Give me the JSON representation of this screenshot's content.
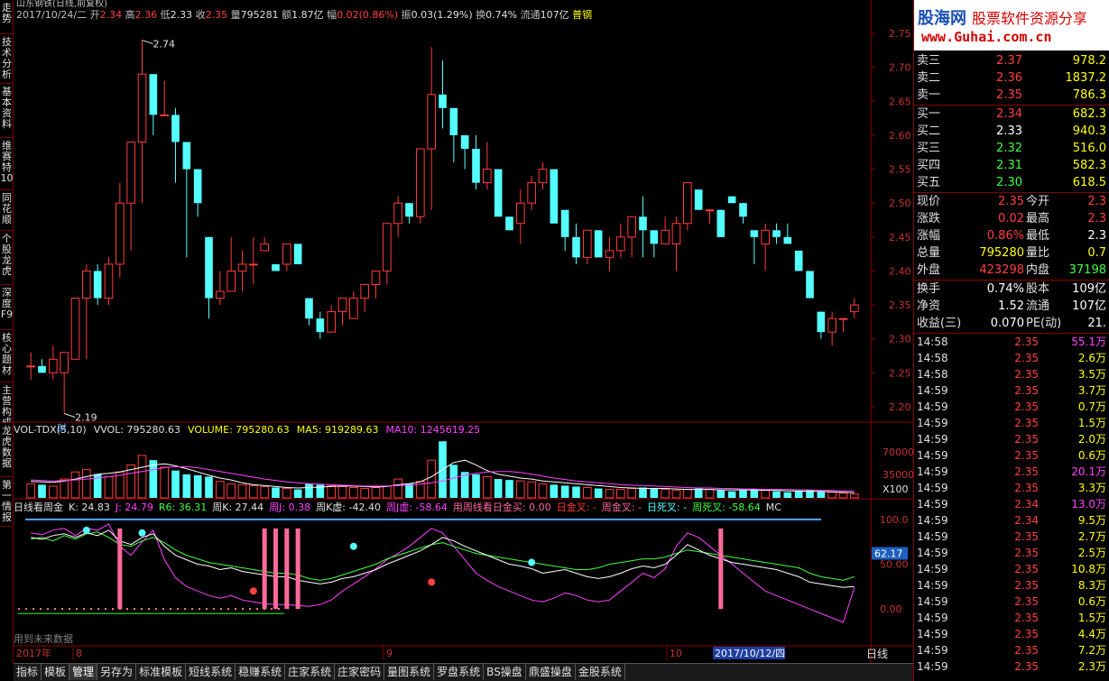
{
  "colors": {
    "up": "#ff3b3b",
    "down": "#54ffff",
    "grid": "#8b0000",
    "axis_text": "#c83232",
    "yellow": "#ffff00",
    "magenta": "#ff40ff",
    "green": "#40ff40",
    "white": "#ffffff",
    "blue": "#4fa8ff",
    "pink": "#ff6a9a"
  },
  "left_tabs": [
    "走势",
    "技术分析",
    "基本资料",
    "维赛特10",
    "同花顺",
    "个股龙虎",
    "深度F9",
    "核心题材",
    "主营构成",
    "龙虎数据",
    "第一情报"
  ],
  "header": {
    "title": "山东钢铁(日线,前复权)",
    "date": "2017/10/24/二",
    "open_label": "开",
    "open": "2.34",
    "high_label": "高",
    "high": "2.36",
    "low_label": "低",
    "low": "2.33",
    "close_label": "收",
    "close": "2.35",
    "vol_label": "量",
    "vol": "795281",
    "amt_label": "额",
    "amt": "1.87亿",
    "chg_label": "幅",
    "chg": "0.02(0.86%)",
    "amp_label": "振",
    "amp": "0.03(1.29%)",
    "turn_label": "换",
    "turn": "0.74%",
    "float_label": "流通",
    "float": "107亿",
    "industry": "普钢"
  },
  "price_axis": {
    "ticks": [
      "2.75",
      "2.70",
      "2.65",
      "2.60",
      "2.55",
      "2.50",
      "2.45",
      "2.40",
      "2.35",
      "2.30",
      "2.25",
      "2.20"
    ],
    "max_label": "2.74",
    "min_label": "2.19",
    "fin_marker": "财"
  },
  "volume_panel": {
    "name": "VOL-TDX(5,10)",
    "vvol": "VVOL: 795280.63",
    "volume": "VOLUME: 795280.63",
    "ma5": "MA5: 919289.63",
    "ma10": "MA10: 1245619.25",
    "ticks": [
      "70000",
      "35000"
    ],
    "unit": "X100"
  },
  "kdj_panel": {
    "name": "日线看周金",
    "k": "K: 24.83",
    "j": "J: 24.79",
    "r6": "R6: 36.31",
    "zk": "周K: 27.44",
    "zj": "周J: 0.38",
    "zkx": "周K虚: -42.40",
    "zjx": "周J虚: -58.64",
    "buy": "用周线看日金买: 0.00",
    "rjc": "日金叉: -",
    "zjc": "周金叉: -",
    "rsc": "日死叉: -",
    "zsc": "周死叉: -58.64",
    "mc": "MC",
    "ticks": [
      "100.0",
      "50.00",
      "0.00"
    ],
    "cur_value": "62.17",
    "future_note": "用到未来数据"
  },
  "date_axis": {
    "year": "2017年",
    "m8": "8",
    "m9": "9",
    "m10": "10",
    "cursor_date": "2017/10/12/四"
  },
  "period": "日线",
  "bottom_tabs": [
    "指标",
    "模板",
    "管理",
    "另存为",
    "标准模板",
    "短线系统",
    "稳赚系统",
    "庄家系统",
    "庄家密码",
    "量图系统",
    "罗盘系统",
    "BS操盘",
    "鼎盛操盘",
    "金股系统"
  ],
  "logo": {
    "name": "股海网",
    "slogan": "股票软件资源分享",
    "url": "www.Guhai.com.cn"
  },
  "sell_book": [
    {
      "label": "卖三",
      "price": "2.37",
      "vol": "978.2"
    },
    {
      "label": "卖二",
      "price": "2.36",
      "vol": "1837.2"
    },
    {
      "label": "卖一",
      "price": "2.35",
      "vol": "786.3"
    }
  ],
  "buy_book": [
    {
      "label": "买一",
      "price": "2.34",
      "vol": "682.3"
    },
    {
      "label": "买二",
      "price": "2.33",
      "vol": "940.3"
    },
    {
      "label": "买三",
      "price": "2.32",
      "vol": "516.0"
    },
    {
      "label": "买四",
      "price": "2.31",
      "vol": "582.3"
    },
    {
      "label": "买五",
      "price": "2.30",
      "vol": "618.5"
    }
  ],
  "stats": [
    {
      "k1": "现价",
      "v1": "2.35",
      "k2": "今开",
      "v2": "2.3"
    },
    {
      "k1": "涨跌",
      "v1": "0.02",
      "k2": "最高",
      "v2": "2.3"
    },
    {
      "k1": "涨幅",
      "v1": "0.86%",
      "k2": "最低",
      "v2": "2.3"
    },
    {
      "k1": "总量",
      "v1": "795280",
      "k2": "量比",
      "v2": "0.7"
    },
    {
      "k1": "外盘",
      "v1": "423298",
      "k2": "内盘",
      "v2": "37198"
    }
  ],
  "fund": [
    {
      "k1": "换手",
      "v1": "0.74%",
      "k2": "股本",
      "v2": "109亿"
    },
    {
      "k1": "净资",
      "v1": "1.52",
      "k2": "流通",
      "v2": "107亿"
    },
    {
      "k1": "收益(三)",
      "v1": "0.070",
      "k2": "PE(动)",
      "v2": "21."
    }
  ],
  "ticks": [
    {
      "t": "14:58",
      "p": "2.35",
      "v": "55.1万",
      "c": "magenta"
    },
    {
      "t": "14:58",
      "p": "2.35",
      "v": "2.6万",
      "c": "yellow"
    },
    {
      "t": "14:58",
      "p": "2.35",
      "v": "3.5万",
      "c": "yellow"
    },
    {
      "t": "14:59",
      "p": "2.35",
      "v": "3.7万",
      "c": "yellow"
    },
    {
      "t": "14:59",
      "p": "2.35",
      "v": "0.7万",
      "c": "yellow"
    },
    {
      "t": "14:59",
      "p": "2.35",
      "v": "1.5万",
      "c": "yellow"
    },
    {
      "t": "14:59",
      "p": "2.35",
      "v": "2.0万",
      "c": "yellow"
    },
    {
      "t": "14:59",
      "p": "2.35",
      "v": "0.6万",
      "c": "yellow"
    },
    {
      "t": "14:59",
      "p": "2.35",
      "v": "20.1万",
      "c": "magenta"
    },
    {
      "t": "14:59",
      "p": "2.35",
      "v": "3.3万",
      "c": "yellow"
    },
    {
      "t": "14:59",
      "p": "2.34",
      "v": "13.0万",
      "c": "magenta"
    },
    {
      "t": "14:59",
      "p": "2.34",
      "v": "9.5万",
      "c": "yellow"
    },
    {
      "t": "14:59",
      "p": "2.35",
      "v": "2.7万",
      "c": "yellow"
    },
    {
      "t": "14:59",
      "p": "2.35",
      "v": "2.5万",
      "c": "yellow"
    },
    {
      "t": "14:59",
      "p": "2.35",
      "v": "10.8万",
      "c": "yellow"
    },
    {
      "t": "14:59",
      "p": "2.35",
      "v": "8.3万",
      "c": "yellow"
    },
    {
      "t": "14:59",
      "p": "2.35",
      "v": "0.6万",
      "c": "yellow"
    },
    {
      "t": "14:59",
      "p": "2.35",
      "v": "1.5万",
      "c": "yellow"
    },
    {
      "t": "14:59",
      "p": "2.35",
      "v": "4.4万",
      "c": "yellow"
    },
    {
      "t": "14:59",
      "p": "2.35",
      "v": "7.2万",
      "c": "yellow"
    },
    {
      "t": "14:59",
      "p": "2.35",
      "v": "2.3万",
      "c": "yellow"
    }
  ],
  "chart_data": {
    "type": "candlestick",
    "title": "山东钢铁(日线,前复权)",
    "ylim": [
      2.18,
      2.77
    ],
    "max": 2.74,
    "min": 2.19,
    "candles": [
      [
        2.26,
        2.28,
        2.24,
        2.26
      ],
      [
        2.26,
        2.27,
        2.25,
        2.25
      ],
      [
        2.25,
        2.29,
        2.24,
        2.27
      ],
      [
        2.25,
        2.28,
        2.19,
        2.28
      ],
      [
        2.27,
        2.36,
        2.27,
        2.36
      ],
      [
        2.36,
        2.41,
        2.27,
        2.4
      ],
      [
        2.4,
        2.41,
        2.35,
        2.36
      ],
      [
        2.36,
        2.42,
        2.35,
        2.41
      ],
      [
        2.41,
        2.53,
        2.39,
        2.5
      ],
      [
        2.5,
        2.59,
        2.43,
        2.59
      ],
      [
        2.59,
        2.74,
        2.5,
        2.69
      ],
      [
        2.69,
        2.69,
        2.6,
        2.63
      ],
      [
        2.63,
        2.68,
        2.63,
        2.63
      ],
      [
        2.63,
        2.64,
        2.53,
        2.59
      ],
      [
        2.59,
        2.59,
        2.42,
        2.55
      ],
      [
        2.55,
        2.55,
        2.48,
        2.5
      ],
      [
        2.45,
        2.45,
        2.33,
        2.36
      ],
      [
        2.36,
        2.4,
        2.35,
        2.37
      ],
      [
        2.37,
        2.45,
        2.37,
        2.4
      ],
      [
        2.4,
        2.43,
        2.37,
        2.41
      ],
      [
        2.41,
        2.45,
        2.38,
        2.41
      ],
      [
        2.43,
        2.45,
        2.43,
        2.44
      ],
      [
        2.41,
        2.41,
        2.4,
        2.4
      ],
      [
        2.41,
        2.44,
        2.4,
        2.44
      ],
      [
        2.44,
        2.44,
        2.41,
        2.41
      ],
      [
        2.36,
        2.36,
        2.32,
        2.33
      ],
      [
        2.33,
        2.34,
        2.3,
        2.31
      ],
      [
        2.31,
        2.35,
        2.31,
        2.34
      ],
      [
        2.34,
        2.36,
        2.32,
        2.36
      ],
      [
        2.33,
        2.37,
        2.33,
        2.36
      ],
      [
        2.36,
        2.38,
        2.34,
        2.38
      ],
      [
        2.38,
        2.4,
        2.36,
        2.4
      ],
      [
        2.4,
        2.47,
        2.38,
        2.47
      ],
      [
        2.47,
        2.51,
        2.45,
        2.5
      ],
      [
        2.5,
        2.5,
        2.47,
        2.48
      ],
      [
        2.48,
        2.58,
        2.47,
        2.58
      ],
      [
        2.58,
        2.73,
        2.49,
        2.66
      ],
      [
        2.66,
        2.71,
        2.61,
        2.64
      ],
      [
        2.64,
        2.64,
        2.56,
        2.6
      ],
      [
        2.6,
        2.6,
        2.55,
        2.58
      ],
      [
        2.58,
        2.6,
        2.52,
        2.53
      ],
      [
        2.53,
        2.59,
        2.52,
        2.55
      ],
      [
        2.55,
        2.55,
        2.48,
        2.48
      ],
      [
        2.48,
        2.48,
        2.46,
        2.46
      ],
      [
        2.47,
        2.52,
        2.44,
        2.5
      ],
      [
        2.5,
        2.54,
        2.49,
        2.53
      ],
      [
        2.53,
        2.56,
        2.52,
        2.55
      ],
      [
        2.55,
        2.55,
        2.47,
        2.47
      ],
      [
        2.49,
        2.49,
        2.43,
        2.45
      ],
      [
        2.45,
        2.47,
        2.41,
        2.42
      ],
      [
        2.42,
        2.46,
        2.41,
        2.46
      ],
      [
        2.46,
        2.46,
        2.42,
        2.42
      ],
      [
        2.42,
        2.45,
        2.4,
        2.43
      ],
      [
        2.43,
        2.47,
        2.42,
        2.45
      ],
      [
        2.45,
        2.48,
        2.42,
        2.48
      ],
      [
        2.48,
        2.51,
        2.42,
        2.46
      ],
      [
        2.46,
        2.46,
        2.42,
        2.44
      ],
      [
        2.44,
        2.48,
        2.44,
        2.46
      ],
      [
        2.44,
        2.48,
        2.4,
        2.47
      ],
      [
        2.47,
        2.53,
        2.46,
        2.53
      ],
      [
        2.52,
        2.52,
        2.49,
        2.49
      ],
      [
        2.49,
        2.49,
        2.47,
        2.49
      ],
      [
        2.49,
        2.49,
        2.45,
        2.45
      ],
      [
        2.51,
        2.51,
        2.5,
        2.5
      ],
      [
        2.5,
        2.5,
        2.47,
        2.48
      ],
      [
        2.46,
        2.46,
        2.41,
        2.45
      ],
      [
        2.44,
        2.47,
        2.4,
        2.46
      ],
      [
        2.46,
        2.47,
        2.44,
        2.45
      ],
      [
        2.45,
        2.47,
        2.44,
        2.44
      ],
      [
        2.43,
        2.43,
        2.4,
        2.4
      ],
      [
        2.4,
        2.4,
        2.36,
        2.36
      ],
      [
        2.34,
        2.34,
        2.3,
        2.31
      ],
      [
        2.31,
        2.34,
        2.29,
        2.33
      ],
      [
        2.33,
        2.33,
        2.31,
        2.33
      ],
      [
        2.34,
        2.36,
        2.33,
        2.35
      ]
    ],
    "volume": [
      30,
      28,
      25,
      40,
      55,
      60,
      50,
      45,
      55,
      70,
      90,
      80,
      65,
      58,
      50,
      48,
      45,
      35,
      30,
      28,
      26,
      24,
      22,
      20,
      18,
      30,
      28,
      26,
      24,
      22,
      20,
      22,
      25,
      40,
      30,
      35,
      80,
      120,
      70,
      55,
      50,
      45,
      40,
      38,
      36,
      34,
      30,
      28,
      26,
      24,
      22,
      20,
      18,
      18,
      20,
      22,
      20,
      18,
      16,
      18,
      20,
      18,
      16,
      14,
      16,
      18,
      16,
      14,
      12,
      14,
      16,
      14,
      12,
      10,
      8
    ],
    "vol_ma5": [
      35,
      34,
      33,
      36,
      40,
      45,
      50,
      52,
      55,
      60,
      65,
      70,
      72,
      68,
      62,
      55,
      48,
      42,
      38,
      32,
      28,
      26,
      24,
      22,
      21,
      22,
      23,
      24,
      25,
      25,
      24,
      23,
      24,
      28,
      30,
      34,
      45,
      60,
      75,
      80,
      70,
      58,
      50,
      46,
      42,
      40,
      36,
      34,
      32,
      30,
      28,
      26,
      24,
      22,
      21,
      20,
      20,
      20,
      19,
      18,
      18,
      18,
      17,
      17,
      17,
      17,
      16,
      16,
      15,
      15,
      14,
      14,
      13,
      12,
      11
    ],
    "vol_ma10": [
      38,
      37,
      36,
      37,
      38,
      40,
      42,
      45,
      48,
      52,
      56,
      60,
      64,
      66,
      66,
      64,
      60,
      56,
      52,
      48,
      44,
      40,
      37,
      34,
      32,
      30,
      29,
      28,
      27,
      26,
      25,
      25,
      25,
      26,
      27,
      29,
      32,
      36,
      42,
      48,
      52,
      55,
      56,
      56,
      54,
      50,
      46,
      42,
      39,
      36,
      34,
      32,
      30,
      28,
      27,
      26,
      25,
      24,
      23,
      22,
      21,
      21,
      20,
      20,
      19,
      19,
      18,
      18,
      18,
      17,
      17,
      16,
      16,
      15,
      15
    ]
  }
}
